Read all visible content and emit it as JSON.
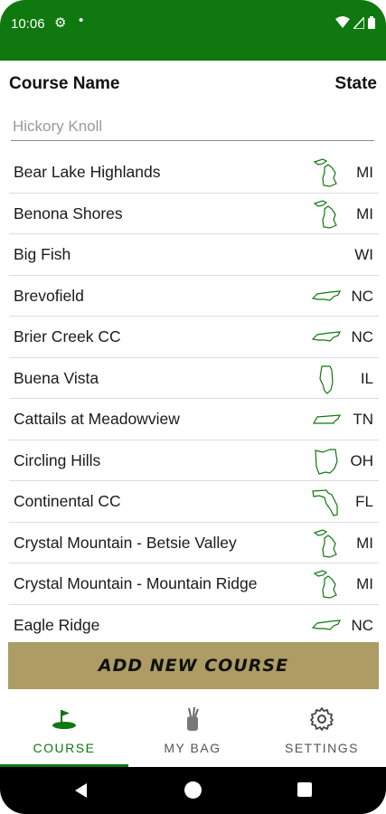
{
  "status_bar": {
    "time": "10:06",
    "icons": [
      "gear-icon",
      "dot-icon",
      "wifi-icon",
      "signal-icon",
      "battery-icon"
    ]
  },
  "header": {
    "course_name_label": "Course Name",
    "state_label": "State"
  },
  "search": {
    "placeholder": "Hickory Knoll"
  },
  "courses": [
    {
      "name": "Bear Lake Highlands",
      "state": "MI",
      "shape": "michigan-shape-icon"
    },
    {
      "name": "Benona Shores",
      "state": "MI",
      "shape": "michigan-shape-icon"
    },
    {
      "name": "Big Fish",
      "state": "WI",
      "shape": ""
    },
    {
      "name": "Brevofield",
      "state": "NC",
      "shape": "north-carolina-shape-icon"
    },
    {
      "name": "Brier Creek CC",
      "state": "NC",
      "shape": "north-carolina-shape-icon"
    },
    {
      "name": "Buena Vista",
      "state": "IL",
      "shape": "illinois-shape-icon"
    },
    {
      "name": "Cattails at Meadowview",
      "state": "TN",
      "shape": "tennessee-shape-icon"
    },
    {
      "name": "Circling Hills",
      "state": "OH",
      "shape": "ohio-shape-icon"
    },
    {
      "name": "Continental CC",
      "state": "FL",
      "shape": "florida-shape-icon"
    },
    {
      "name": "Crystal Mountain - Betsie Valley",
      "state": "MI",
      "shape": "michigan-shape-icon"
    },
    {
      "name": "Crystal Mountain - Mountain Ridge",
      "state": "MI",
      "shape": "michigan-shape-icon"
    },
    {
      "name": "Eagle Ridge",
      "state": "NC",
      "shape": "north-carolina-shape-icon"
    }
  ],
  "add_button": {
    "label": "ADD NEW COURSE"
  },
  "bottom_nav": {
    "course_label": "COURSE",
    "bag_label": "MY BAG",
    "settings_label": "SETTINGS",
    "active": "COURSE"
  },
  "colors": {
    "brand_green": "#0f780f",
    "button_gold": "#ad9c63"
  }
}
